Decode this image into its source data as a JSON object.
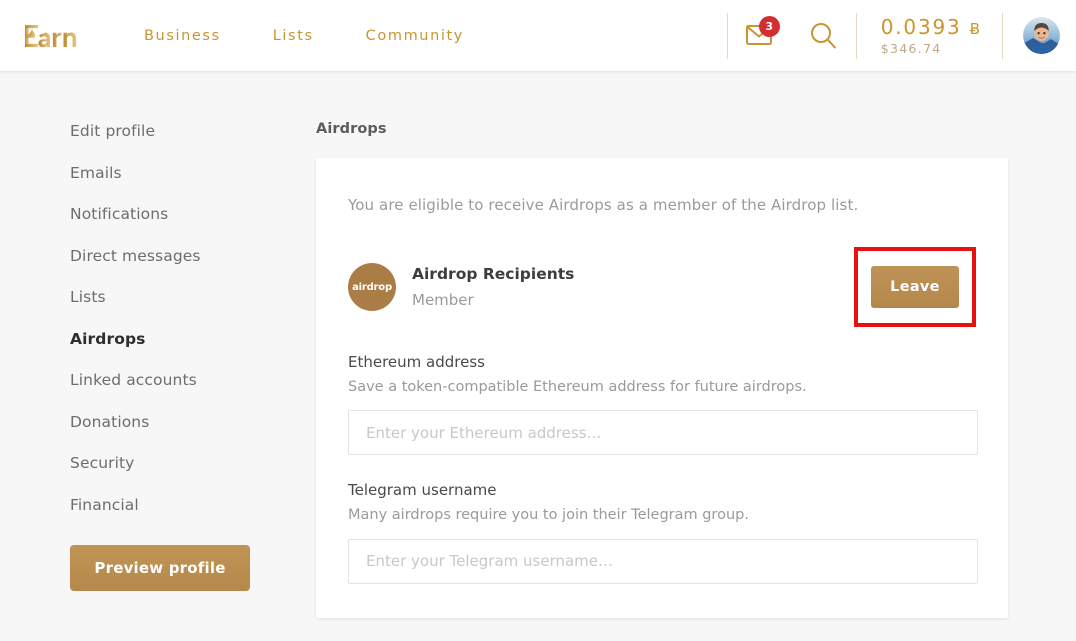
{
  "header": {
    "logo_text": "Earn",
    "logo_icon": "earn-logo",
    "nav": [
      {
        "label": "Business"
      },
      {
        "label": "Lists"
      },
      {
        "label": "Community"
      }
    ],
    "mail_icon": "envelope-icon",
    "mail_badge_count": "3",
    "search_icon": "search-icon",
    "balance_btc": "0.0393",
    "balance_btc_symbol": "Ƀ",
    "balance_usd": "$346.74",
    "avatar": "user-avatar",
    "accent_color": "#c9952f"
  },
  "sidebar": {
    "items": [
      {
        "label": "Edit profile",
        "active": false
      },
      {
        "label": "Emails",
        "active": false
      },
      {
        "label": "Notifications",
        "active": false
      },
      {
        "label": "Direct messages",
        "active": false
      },
      {
        "label": "Lists",
        "active": false
      },
      {
        "label": "Airdrops",
        "active": true
      },
      {
        "label": "Linked accounts",
        "active": false
      },
      {
        "label": "Donations",
        "active": false
      },
      {
        "label": "Security",
        "active": false
      },
      {
        "label": "Financial",
        "active": false
      }
    ],
    "preview_button": "Preview profile",
    "button_color": "#bb8e4f"
  },
  "main": {
    "section_title": "Airdrops",
    "eligible_text": "You are eligible to receive Airdrops as a member of the Airdrop list.",
    "list": {
      "avatar_text": "airdrop",
      "avatar_color": "#ab7d46",
      "name": "Airdrop Recipients",
      "role": "Member",
      "leave_button": "Leave",
      "leave_button_color": "#b98d51",
      "highlight_color": "#e81010"
    },
    "fields": [
      {
        "label": "Ethereum address",
        "help": "Save a token-compatible Ethereum address for future airdrops.",
        "placeholder": "Enter your Ethereum address…",
        "value": ""
      },
      {
        "label": "Telegram username",
        "help": "Many airdrops require you to join their Telegram group.",
        "placeholder": "Enter your Telegram username…",
        "value": ""
      }
    ]
  }
}
